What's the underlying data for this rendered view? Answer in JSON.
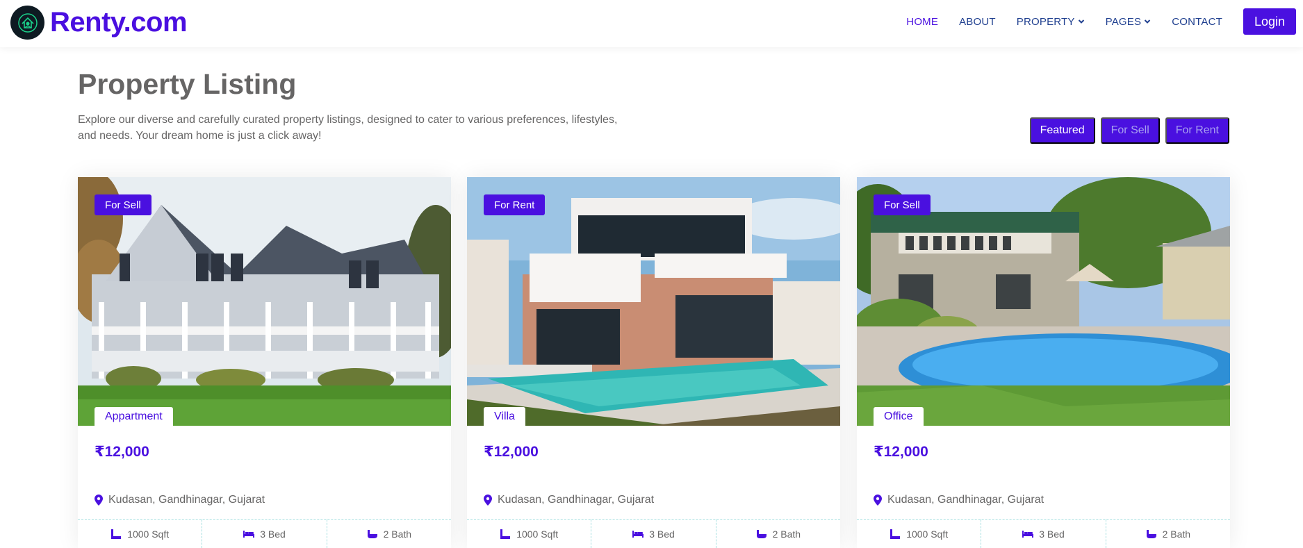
{
  "brand": {
    "name": "Renty.com"
  },
  "nav": {
    "items": [
      {
        "label": "HOME",
        "active": true,
        "dropdown": false
      },
      {
        "label": "ABOUT",
        "active": false,
        "dropdown": false
      },
      {
        "label": "PROPERTY",
        "active": false,
        "dropdown": true
      },
      {
        "label": "PAGES",
        "active": false,
        "dropdown": true
      },
      {
        "label": "CONTACT",
        "active": false,
        "dropdown": false
      }
    ],
    "login_label": "Login"
  },
  "header": {
    "title": "Property Listing",
    "description": "Explore our diverse and carefully curated property listings, designed to cater to various preferences, lifestyles, and needs. Your dream home is just a click away!"
  },
  "filters": [
    {
      "label": "Featured",
      "active": true
    },
    {
      "label": "For Sell",
      "active": false
    },
    {
      "label": "For Rent",
      "active": false
    }
  ],
  "listings": [
    {
      "status": "For Sell",
      "type": "Appartment",
      "price": "₹12,000",
      "address": "Kudasan, Gandhinagar, Gujarat",
      "area": "1000 Sqft",
      "beds": "3 Bed",
      "baths": "2 Bath",
      "image": "gray-shingle-house-with-porch"
    },
    {
      "status": "For Rent",
      "type": "Villa",
      "price": "₹12,000",
      "address": "Kudasan, Gandhinagar, Gujarat",
      "area": "1000 Sqft",
      "beds": "3 Bed",
      "baths": "2 Bath",
      "image": "modern-villa-with-pool"
    },
    {
      "status": "For Sell",
      "type": "Office",
      "price": "₹12,000",
      "address": "Kudasan, Gandhinagar, Gujarat",
      "area": "1000 Sqft",
      "beds": "3 Bed",
      "baths": "2 Bath",
      "image": "house-with-backyard-pool"
    }
  ],
  "colors": {
    "accent": "#4a10e0",
    "nav_text": "#1f3f8f",
    "body_text": "#666565",
    "divider": "#a6dfe0"
  }
}
